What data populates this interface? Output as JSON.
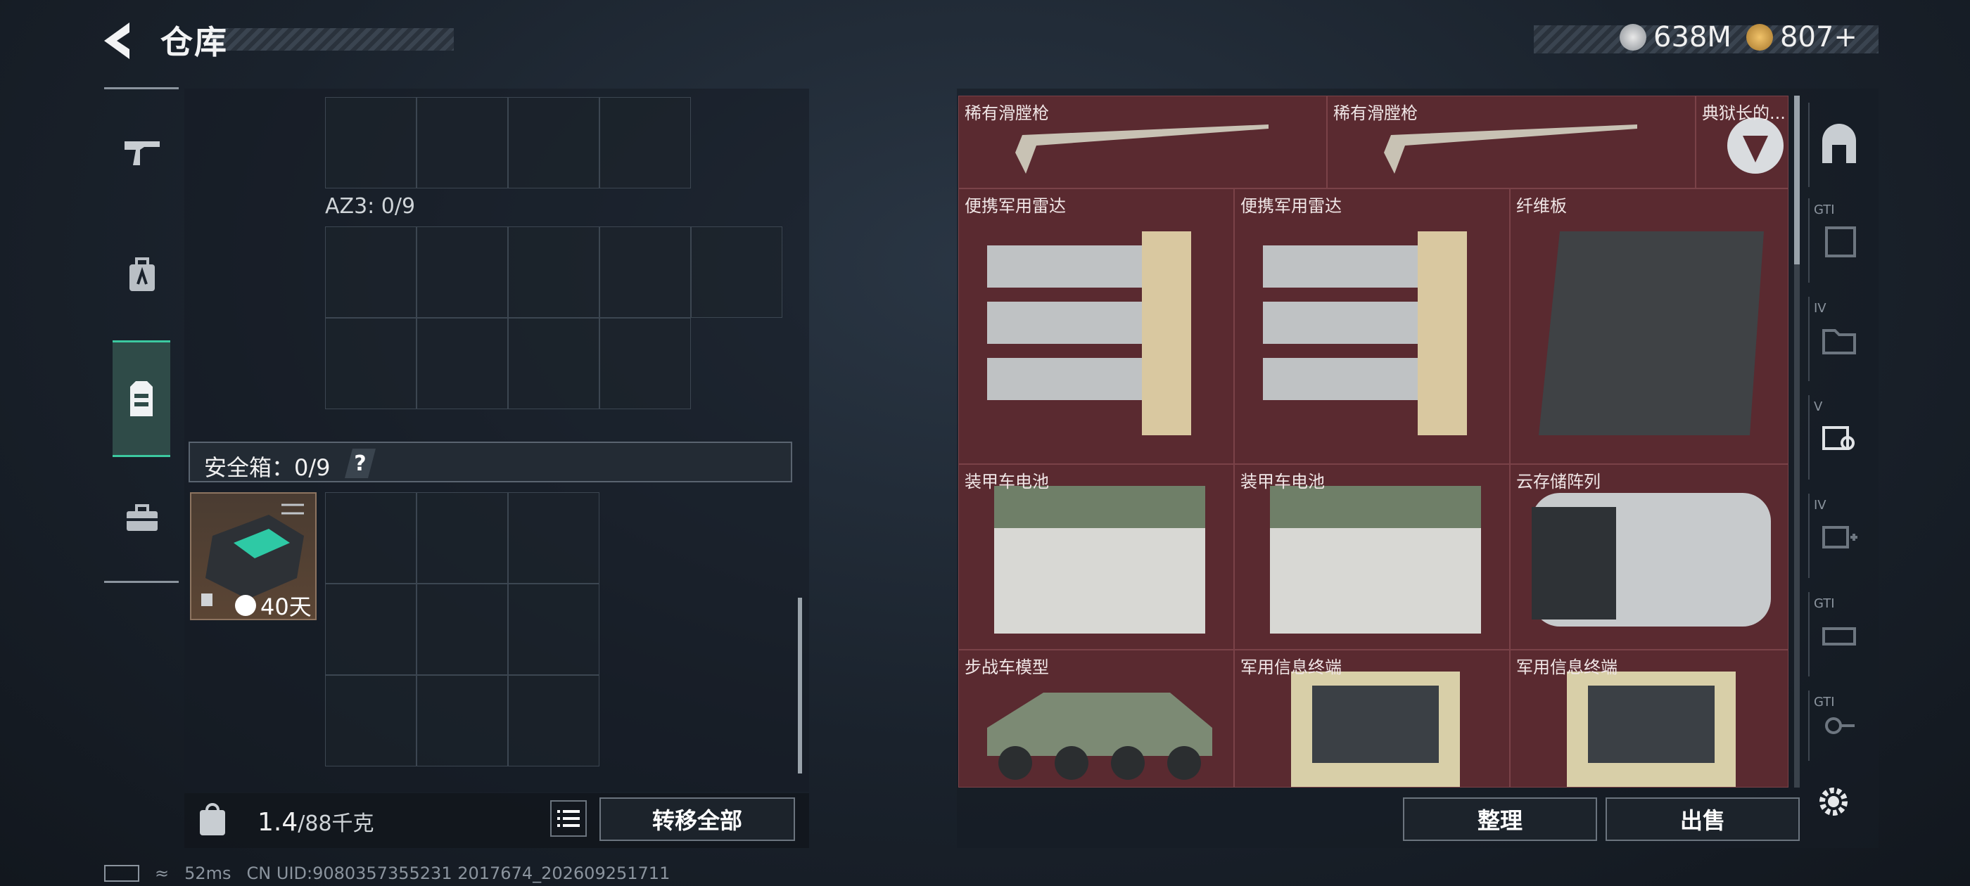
{
  "header": {
    "title": "仓库"
  },
  "currency": {
    "silver": "638M",
    "gold": "807+"
  },
  "left_nav": [
    "gun-icon",
    "backpack-icon",
    "vest-icon",
    "toolbox-icon"
  ],
  "left_panel": {
    "az3_label": "AZ3: 0/9",
    "safe_box_label": "安全箱：0/9",
    "help_label": "?",
    "case_time": "40天",
    "weight_current": "1.4",
    "weight_total": "/88千克",
    "transfer_all": "转移全部"
  },
  "status_bar": {
    "ping": "52ms",
    "uid": "CN UID:9080357355231 2017674_202609251711"
  },
  "stash": {
    "items": [
      {
        "label": "稀有滑膛枪"
      },
      {
        "label": "稀有滑膛枪"
      },
      {
        "label": "典狱长的..."
      },
      {
        "label": "便携军用雷达"
      },
      {
        "label": "便携军用雷达"
      },
      {
        "label": "纤维板"
      },
      {
        "label": "装甲车电池"
      },
      {
        "label": "装甲车电池"
      },
      {
        "label": "云存储阵列"
      },
      {
        "label": "步战车模型"
      },
      {
        "label": "军用信息终端"
      },
      {
        "label": "军用信息终端"
      }
    ],
    "sort_label": "整理",
    "sell_label": "出售"
  },
  "side_tabs": [
    {
      "tag": ""
    },
    {
      "tag": "GTI"
    },
    {
      "tag": "IV"
    },
    {
      "tag": "V"
    },
    {
      "tag": "IV"
    },
    {
      "tag": "GTI"
    },
    {
      "tag": "GTI"
    }
  ]
}
